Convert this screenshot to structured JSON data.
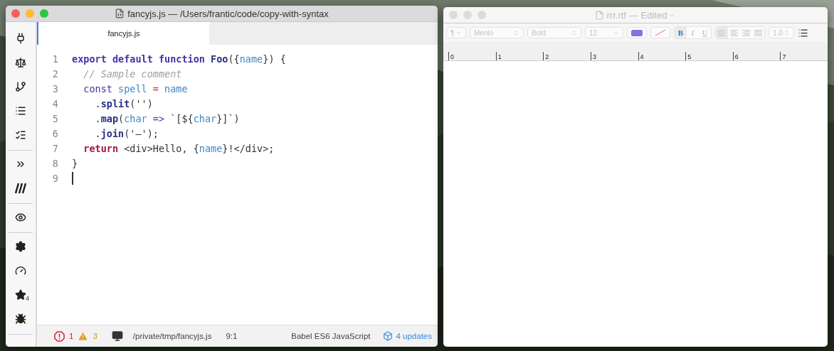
{
  "editor": {
    "title": "fancyjs.js — /Users/frantic/code/copy-with-syntax",
    "sidebar": [
      {
        "items": [
          {
            "kind": "plug"
          },
          {
            "kind": "scale"
          },
          {
            "kind": "branch"
          },
          {
            "kind": "list"
          },
          {
            "kind": "checklist"
          }
        ]
      },
      {
        "items": [
          {
            "kind": "chevrons"
          },
          {
            "kind": "slashes"
          }
        ]
      },
      {
        "items": [
          {
            "kind": "eye"
          }
        ]
      },
      {
        "items": [
          {
            "kind": "gear"
          },
          {
            "kind": "gauge"
          },
          {
            "kind": "star",
            "badge": "4"
          },
          {
            "kind": "bug"
          }
        ]
      }
    ],
    "tabs": [
      {
        "label": "fancyjs.js",
        "selected": true
      }
    ],
    "lines": [
      {
        "number": "1",
        "tokens": [
          {
            "text": "export default function ",
            "kind": "keyword"
          },
          {
            "text": "Foo",
            "kind": "func"
          },
          {
            "text": "({",
            "kind": "plain"
          },
          {
            "text": "name",
            "kind": "var"
          },
          {
            "text": "}) {",
            "kind": "plain"
          }
        ]
      },
      {
        "number": "2",
        "tokens": [
          {
            "text": "  // Sample comment",
            "kind": "comment"
          }
        ]
      },
      {
        "number": "3",
        "tokens": [
          {
            "text": "  const ",
            "kind": "storage"
          },
          {
            "text": "spell",
            "kind": "var"
          },
          {
            "text": " = ",
            "kind": "operator"
          },
          {
            "text": "name",
            "kind": "var"
          }
        ]
      },
      {
        "number": "4",
        "tokens": [
          {
            "text": "    .",
            "kind": "plain"
          },
          {
            "text": "split",
            "kind": "func"
          },
          {
            "text": "('')",
            "kind": "plain"
          }
        ]
      },
      {
        "number": "5",
        "tokens": [
          {
            "text": "    .",
            "kind": "plain"
          },
          {
            "text": "map",
            "kind": "func"
          },
          {
            "text": "(",
            "kind": "plain"
          },
          {
            "text": "char",
            "kind": "var"
          },
          {
            "text": " => ",
            "kind": "storage"
          },
          {
            "text": "`[${",
            "kind": "plain"
          },
          {
            "text": "char",
            "kind": "var"
          },
          {
            "text": "}]`)",
            "kind": "plain"
          }
        ]
      },
      {
        "number": "6",
        "tokens": [
          {
            "text": "    .",
            "kind": "plain"
          },
          {
            "text": "join",
            "kind": "func"
          },
          {
            "text": "('–');",
            "kind": "plain"
          }
        ]
      },
      {
        "number": "7",
        "tokens": [
          {
            "text": "  return ",
            "kind": "control"
          },
          {
            "text": "<div>Hello, {",
            "kind": "plain"
          },
          {
            "text": "name",
            "kind": "var"
          },
          {
            "text": "}!</div>;",
            "kind": "plain"
          }
        ]
      },
      {
        "number": "8",
        "tokens": [
          {
            "text": "}",
            "kind": "plain"
          }
        ]
      },
      {
        "number": "9",
        "cursor": true
      }
    ],
    "status": {
      "errors": "1",
      "warnings": "3",
      "path": "/private/tmp/fancyjs.js",
      "position": "9:1",
      "grammar": "Babel ES6 JavaScript",
      "updates": "4 updates"
    }
  },
  "textedit": {
    "title": "rrr.rtf",
    "edited": "— Edited",
    "toolbar": [
      {
        "kind": "paragraph",
        "label": "¶"
      },
      {
        "kind": "font",
        "label": "Menlo"
      },
      {
        "kind": "font",
        "label": "Bold"
      },
      {
        "kind": "size",
        "label": "12"
      },
      {
        "kind": "swatch",
        "color": "#8a6fe0"
      },
      {
        "kind": "bgcolor"
      },
      {
        "kind": "styles",
        "items": [
          {
            "label": "B",
            "selected": true
          },
          {
            "label": "I",
            "selected": false
          },
          {
            "label": "U",
            "selected": false
          }
        ]
      },
      {
        "kind": "align",
        "items": [
          {
            "selected": true
          },
          {
            "selected": false
          },
          {
            "selected": false
          },
          {
            "selected": false
          }
        ]
      },
      {
        "kind": "spacing",
        "label": "1.0"
      },
      {
        "kind": "list"
      }
    ],
    "ruler": [
      "0",
      "1",
      "2",
      "3",
      "4",
      "5",
      "6",
      "7"
    ]
  }
}
